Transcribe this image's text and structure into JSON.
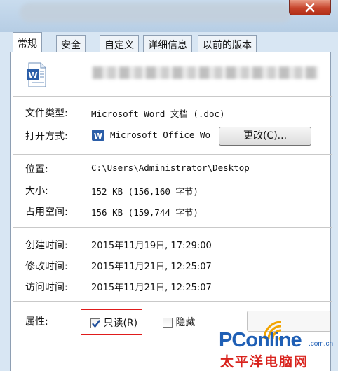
{
  "tabs": [
    "常规",
    "安全",
    "自定义",
    "详细信息",
    "以前的版本"
  ],
  "icons": {
    "file": "word-document-icon",
    "app": "word-app-icon",
    "close": "close-icon",
    "check": "check-icon",
    "watermark": "pconline-logo-icon"
  },
  "fields": {
    "file_type": {
      "label": "文件类型:",
      "value": "Microsoft Word 文档 (.doc)"
    },
    "opens_with": {
      "label": "打开方式:",
      "value": "Microsoft Office Wo",
      "button": "更改(C)..."
    },
    "location": {
      "label": "位置:",
      "value": "C:\\Users\\Administrator\\Desktop"
    },
    "size": {
      "label": "大小:",
      "value": "152 KB (156,160 字节)"
    },
    "size_on_disk": {
      "label": "占用空间:",
      "value": "156 KB (159,744 字节)"
    },
    "created": {
      "label": "创建时间:",
      "value": "2015年11月19日, 17:29:00"
    },
    "modified": {
      "label": "修改时间:",
      "value": "2015年11月21日, 12:25:07"
    },
    "accessed": {
      "label": "访问时间:",
      "value": "2015年11月21日, 12:25:07"
    }
  },
  "attributes": {
    "label": "属性:",
    "readonly": {
      "label": "只读(R)",
      "checked": true
    },
    "hidden": {
      "label": "隐藏",
      "checked": false
    }
  },
  "watermark": {
    "brand": "PConline",
    "domain": ".com.cn",
    "subtitle": "太平洋电脑网"
  },
  "colors": {
    "highlight_box": "#e01b1b",
    "brand_blue": "#1f5fb5",
    "brand_red": "#d9231d"
  }
}
